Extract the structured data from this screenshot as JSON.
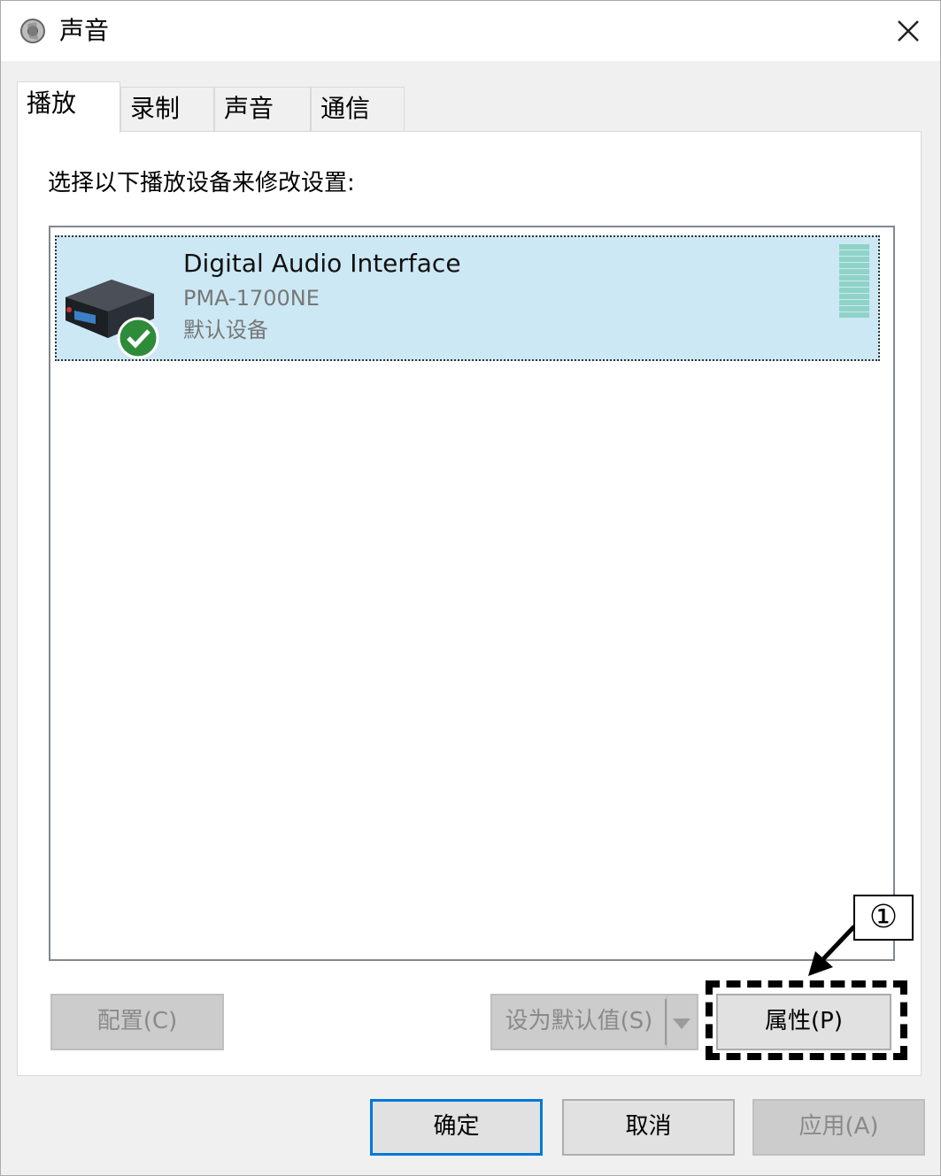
{
  "window": {
    "title": "声音",
    "icon": "speaker-icon"
  },
  "tabs": [
    {
      "label": "播放",
      "active": true
    },
    {
      "label": "录制",
      "active": false
    },
    {
      "label": "声音",
      "active": false
    },
    {
      "label": "通信",
      "active": false
    }
  ],
  "playback": {
    "instruction": "选择以下播放设备来修改设置:",
    "devices": [
      {
        "name": "Digital Audio Interface",
        "model": "PMA-1700NE",
        "status": "默认设备",
        "icon": "audio-device-icon",
        "status_icon": "check-circle-icon",
        "selected": true
      }
    ]
  },
  "buttons": {
    "configure": "配置(C)",
    "set_default": "设为默认值(S)",
    "properties": "属性(P)",
    "ok": "确定",
    "cancel": "取消",
    "apply": "应用(A)"
  },
  "callout": {
    "number": "①"
  },
  "colors": {
    "selection": "#cce8f4",
    "accent": "#0078d7",
    "check": "#2e8b3a",
    "meter": "#8fd3c7"
  }
}
